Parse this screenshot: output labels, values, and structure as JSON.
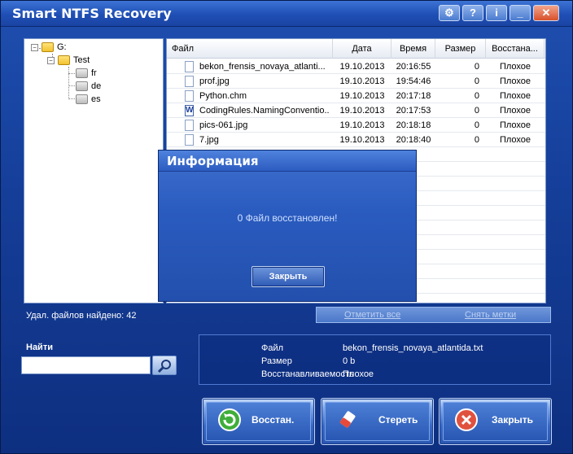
{
  "window": {
    "title": "Smart NTFS Recovery"
  },
  "titlebar_buttons": [
    {
      "icon": "gear-icon",
      "glyph": "⚙"
    },
    {
      "icon": "help-icon",
      "glyph": "?"
    },
    {
      "icon": "info-icon",
      "glyph": "i"
    },
    {
      "icon": "minimize-icon",
      "glyph": "_"
    },
    {
      "icon": "close-icon",
      "glyph": "✕"
    }
  ],
  "tree": {
    "root": "G:",
    "child": "Test",
    "subfolders": [
      "fr",
      "de",
      "es"
    ]
  },
  "file_list": {
    "columns": [
      "Файл",
      "Дата",
      "Время",
      "Размер",
      "Восстана..."
    ],
    "rows": [
      {
        "name": "bekon_frensis_novaya_atlanti...",
        "date": "19.10.2013",
        "time": "20:16:55",
        "size": "0",
        "status": "Плохое",
        "icon": "text-file-icon"
      },
      {
        "name": "prof.jpg",
        "date": "19.10.2013",
        "time": "19:54:46",
        "size": "0",
        "status": "Плохое",
        "icon": "image-file-icon"
      },
      {
        "name": "Python.chm",
        "date": "19.10.2013",
        "time": "20:17:18",
        "size": "0",
        "status": "Плохое",
        "icon": "help-file-icon"
      },
      {
        "name": "CodingRules.NamingConventio...",
        "date": "19.10.2013",
        "time": "20:17:53",
        "size": "0",
        "status": "Плохое",
        "icon": "word-file-icon"
      },
      {
        "name": "pics-061.jpg",
        "date": "19.10.2013",
        "time": "20:18:18",
        "size": "0",
        "status": "Плохое",
        "icon": "image-file-icon"
      },
      {
        "name": "7.jpg",
        "date": "19.10.2013",
        "time": "20:18:40",
        "size": "0",
        "status": "Плохое",
        "icon": "image-file-icon"
      }
    ]
  },
  "found_label": "Удал. файлов найдено: 42",
  "mark_all": "Отметить все",
  "unmark": "Снять метки",
  "search": {
    "label": "Найти",
    "value": "",
    "icon": "search-icon"
  },
  "details": {
    "file_key": "Файл",
    "file_val": "bekon_frensis_novaya_atlantida.txt",
    "size_key": "Размер",
    "size_val": "0 b",
    "rec_key": "Восстанавливаемость",
    "rec_val": "Плохое"
  },
  "buttons": {
    "restore": "Восстан.",
    "erase": "Стереть",
    "close": "Закрыть"
  },
  "dialog": {
    "title": "Информация",
    "message": "0 Файл восстановлен!",
    "close_button": "Закрыть"
  }
}
